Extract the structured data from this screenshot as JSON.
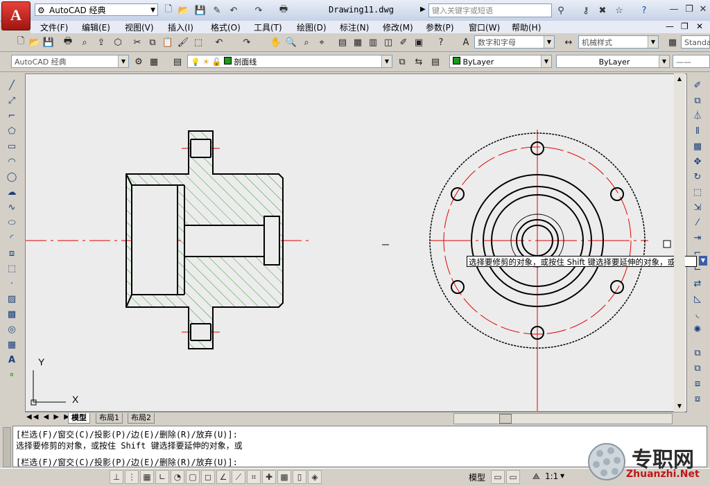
{
  "app": {
    "logo_letter": "A",
    "workspace": "AutoCAD 经典",
    "document_title": "Drawing11.dwg",
    "help_search_placeholder": "键入关键字或短语"
  },
  "menu": [
    "文件(F)",
    "编辑(E)",
    "视图(V)",
    "插入(I)",
    "格式(O)",
    "工具(T)",
    "绘图(D)",
    "标注(N)",
    "修改(M)",
    "参数(P)",
    "窗口(W)",
    "帮助(H)"
  ],
  "styles_toolbar": {
    "text_style": "数字和字母",
    "dim_style": "机械样式",
    "table_style": "Standa"
  },
  "layers_toolbar": {
    "workspace_combo": "AutoCAD 经典",
    "current_layer": "剖面线",
    "color": "ByLayer",
    "linetype": "ByLayer"
  },
  "tabs": [
    "模型",
    "布局1",
    "布局2"
  ],
  "ucs": {
    "x_label": "X",
    "y_label": "Y"
  },
  "tooltip": "选择要修剪的对象，或按住 Shift 键选择要延伸的对象，或",
  "command_lines": [
    "[栏选(F)/窗交(C)/投影(P)/边(E)/删除(R)/放弃(U)]:",
    "选择要修剪的对象，或按住 Shift 键选择要延伸的对象，或",
    "[栏选(F)/窗交(C)/投影(P)/边(E)/删除(R)/放弃(U)]:"
  ],
  "status": {
    "model_label": "模型",
    "scale": "1:1"
  },
  "watermark": {
    "cn": "专职网",
    "en": "Zhuanzhi.Net"
  },
  "colors": {
    "accent_red": "#d01010",
    "centerline": "#e00000",
    "hatch": "#2a9a2a",
    "canvas_bg": "#ececec",
    "tooltip_btn": "#3c5ea8"
  }
}
